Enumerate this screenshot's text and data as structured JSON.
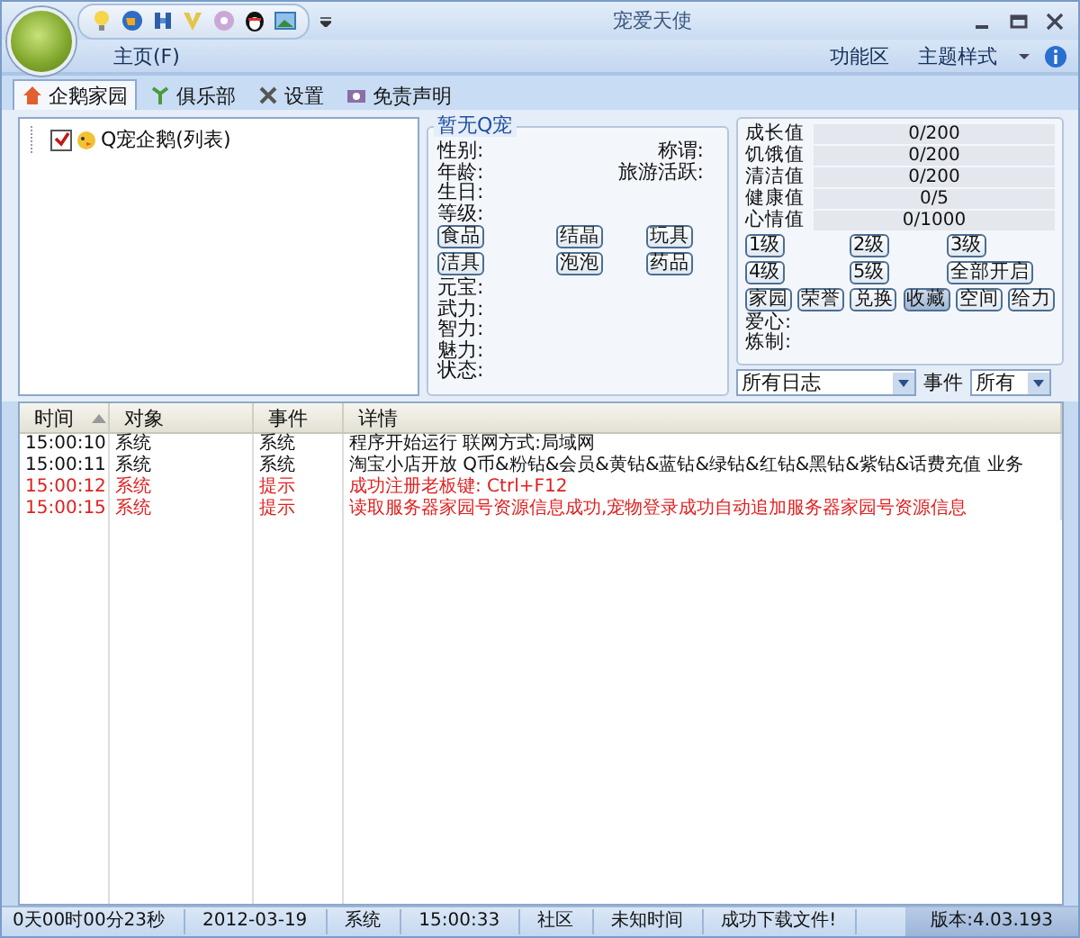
{
  "window": {
    "title": "宠爱天使",
    "menu": "主页(F)",
    "right_menu": [
      "功能区",
      "主题样式"
    ]
  },
  "tabs": [
    {
      "label": "企鹅家园",
      "selected": true
    },
    {
      "label": "俱乐部",
      "selected": false
    },
    {
      "label": "设置",
      "selected": false
    },
    {
      "label": "免责声明",
      "selected": false
    }
  ],
  "tree": [
    {
      "label": "Q宠企鹅(列表)",
      "checked": true
    }
  ],
  "pet": {
    "title": "暂无Q宠",
    "info_top": [
      {
        "left": "性别:",
        "right": "称谓:"
      },
      {
        "left": "年龄:",
        "right": "旅游活跃:"
      },
      {
        "left": "生日:"
      },
      {
        "left": "等级:"
      }
    ],
    "item_buttons": [
      [
        "食品",
        "结晶",
        "玩具"
      ],
      [
        "洁具",
        "泡泡",
        "药品"
      ]
    ],
    "info_bottom": [
      "元宝:",
      "武力:",
      "智力:",
      "魅力:",
      "状态:"
    ]
  },
  "stats": {
    "bars": [
      {
        "label": "成长值",
        "reading": "0/200",
        "level": 0
      },
      {
        "label": "饥饿值",
        "reading": "0/200",
        "level": 0
      },
      {
        "label": "清洁值",
        "reading": "0/200",
        "level": 0
      },
      {
        "label": "健康值",
        "reading": "0/5",
        "level": 0
      },
      {
        "label": "心情值",
        "reading": "0/1000",
        "level": 0
      }
    ],
    "level_buttons": [
      [
        "1级",
        "2级",
        "3级"
      ],
      [
        "4级",
        "5级",
        "全部开启"
      ]
    ],
    "action_buttons": [
      {
        "label": "家园",
        "selected": false
      },
      {
        "label": "荣誉",
        "selected": false
      },
      {
        "label": "兑换",
        "selected": false
      },
      {
        "label": "收藏",
        "selected": true
      },
      {
        "label": "空间",
        "selected": false
      },
      {
        "label": "给力",
        "selected": false
      }
    ],
    "info": [
      "爱心:",
      "炼制:"
    ]
  },
  "filters": {
    "log_filter": "所有日志",
    "event_label": "事件",
    "event_filter": "所有"
  },
  "log": {
    "columns": [
      {
        "label": "时间",
        "sorted": true
      },
      {
        "label": "对象",
        "sorted": false
      },
      {
        "label": "事件",
        "sorted": false
      },
      {
        "label": "详情",
        "sorted": false
      }
    ],
    "rows": [
      {
        "kind": "info",
        "cells": [
          "15:00:10",
          "系统",
          "系统",
          "程序开始运行 联网方式:局域网"
        ]
      },
      {
        "kind": "info",
        "cells": [
          "15:00:11",
          "系统",
          "系统",
          "淘宝小店开放 Q币&粉钻&会员&黄钻&蓝钻&绿钻&红钻&黑钻&紫钻&话费充值 业务"
        ]
      },
      {
        "kind": "alert",
        "cells": [
          "15:00:12",
          "系统",
          "提示",
          "成功注册老板键: Ctrl+F12"
        ]
      },
      {
        "kind": "alert",
        "cells": [
          "15:00:15",
          "系统",
          "提示",
          "读取服务器家园号资源信息成功,宠物登录成功自动追加服务器家园号资源信息"
        ]
      }
    ]
  },
  "status_bar": {
    "items": [
      "0天00时00分23秒",
      "2012-03-19",
      "系统",
      "15:00:33",
      "社区",
      "未知时间",
      "成功下载文件!"
    ],
    "version": "版本:4.03.193"
  }
}
